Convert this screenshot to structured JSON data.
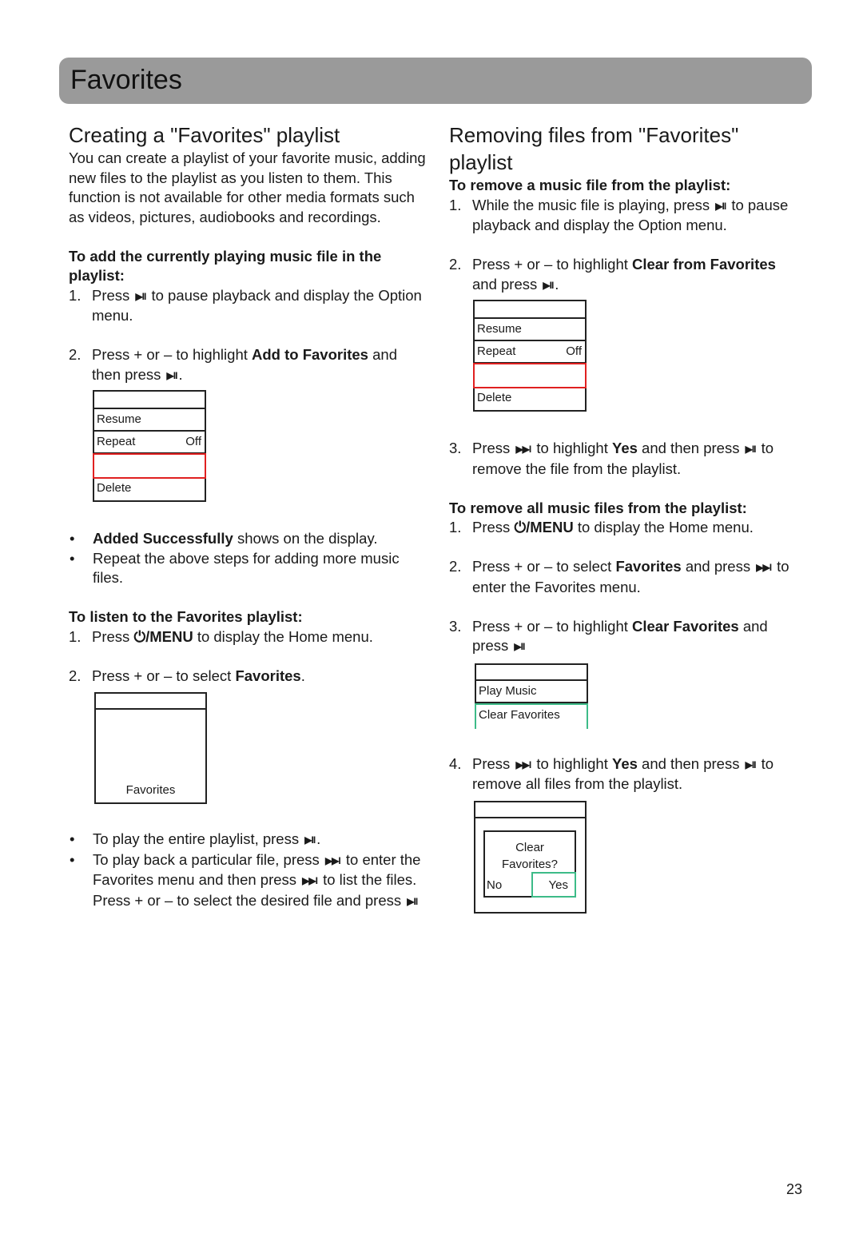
{
  "page": {
    "title": "Favorites",
    "page_number": "23"
  },
  "left": {
    "heading": "Creating a \"Favorites\" playlist",
    "intro": "You can create a playlist of your favorite music, adding new files to the playlist as you listen to them. This function is not available for other media formats such as videos, pictures, audiobooks and recordings.",
    "add_sub": "To add the currently playing music file in the playlist:",
    "add_steps": [
      {
        "n": "1.",
        "a": "Press",
        "icon": "play-pause-icon",
        "b": "to pause playback and display the Option menu."
      },
      {
        "n": "2.",
        "a": "Press + or – to highlight",
        "bold": "Add to Favorites",
        "b": "and then press",
        "icon": "play-pause-icon",
        "c": "."
      }
    ],
    "option_menu": {
      "rows": [
        "",
        "Resume",
        "Repeat",
        "",
        "Delete"
      ],
      "repeat_value": "Off"
    },
    "bullets": [
      {
        "bold": "Added Successfully",
        "text": "shows on the display."
      },
      {
        "text": "Repeat the above steps for adding more music files."
      }
    ],
    "listen_sub": "To listen to the Favorites playlist:",
    "listen_steps": [
      {
        "n": "1.",
        "a": "Press",
        "bold": "⏻/MENU",
        "b": "to display the Home menu."
      },
      {
        "n": "2.",
        "a": "Press + or – to select",
        "bold": "Favorites",
        "b": "."
      }
    ],
    "home_menu": {
      "label": "Favorites"
    },
    "play_bullets": [
      {
        "a": "To play the entire playlist, press",
        "c": "."
      },
      {
        "a": "To play back a particular file, press",
        "b": "to enter the Favorites menu and then press",
        "c": "to list the files. Press + or – to select the desired file and press"
      }
    ]
  },
  "right": {
    "heading": "Removing files from \"Favorites\" playlist",
    "remove_sub": "To remove a music file from the playlist:",
    "remove_steps": [
      {
        "n": "1.",
        "a": "While the music file is playing, press",
        "b": "to pause playback and display the Option menu."
      },
      {
        "n": "2.",
        "a": "Press + or – to highlight",
        "bold": "Clear from Favorites",
        "b": "and press",
        "c": "."
      },
      {
        "n": "3.",
        "a": "Press",
        "b": "to highlight",
        "bold": "Yes",
        "c": "and then press",
        "d": "to remove the file from the playlist."
      }
    ],
    "option_menu": {
      "rows": [
        "",
        "Resume",
        "Repeat",
        "",
        "Delete"
      ],
      "repeat_value": "Off"
    },
    "remove_all_sub": "To remove all music files from the playlist:",
    "remove_all_steps": [
      {
        "n": "1.",
        "a": "Press",
        "bold": "⏻/MENU",
        "b": "to display the Home menu."
      },
      {
        "n": "2.",
        "a": "Press + or – to select",
        "bold": "Favorites",
        "b": "and press",
        "c": "to enter the Favorites menu."
      },
      {
        "n": "3.",
        "a": "Press + or – to highlight",
        "bold": "Clear Favorites",
        "b": "and press"
      },
      {
        "n": "4.",
        "a": "Press",
        "b": "to highlight",
        "bold": "Yes",
        "c": "and then press",
        "d": "to remove all files from the playlist."
      }
    ],
    "fav_menu": {
      "rows": [
        "",
        "Play Music",
        "Clear Favorites"
      ]
    },
    "confirm_dialog": {
      "line1": "Clear",
      "line2": "Favorites?",
      "no": "No",
      "yes": "Yes"
    }
  },
  "icons": {
    "play_pause": "▶II",
    "skip_next": "▶▶I"
  },
  "colors": {
    "banner": "#9a9a9a",
    "highlight_red": "#e02020",
    "highlight_green": "#3dbb88"
  }
}
